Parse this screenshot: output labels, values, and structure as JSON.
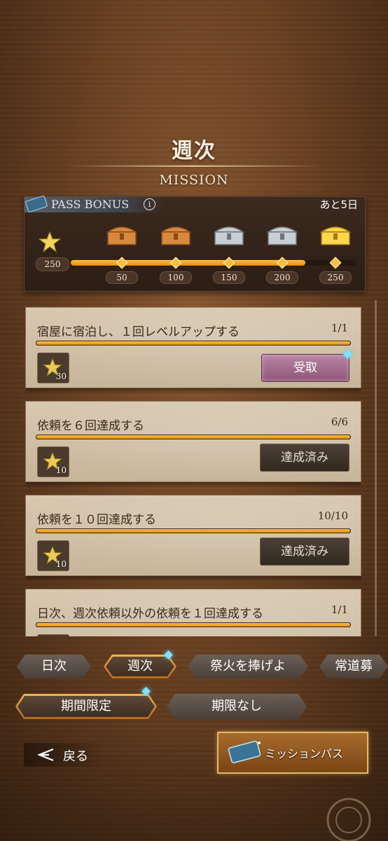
{
  "header": {
    "title": "週次",
    "subtitle": "MISSION"
  },
  "pass_bonus": {
    "label": "PASS BONUS",
    "info_icon": "info-icon",
    "remaining": "あと5日",
    "current_points": "250",
    "progress_fraction": 0.82,
    "milestones": [
      {
        "value": "50",
        "chest": "bronze-chest-icon"
      },
      {
        "value": "100",
        "chest": "bronze-chest-icon"
      },
      {
        "value": "150",
        "chest": "silver-chest-icon"
      },
      {
        "value": "200",
        "chest": "silver-chest-icon"
      },
      {
        "value": "250",
        "chest": "gold-chest-icon"
      }
    ]
  },
  "missions": [
    {
      "title": "宿屋に宿泊し、１回レベルアップする",
      "progress": "1/1",
      "progress_fraction": 1.0,
      "reward": "30",
      "button": "受取",
      "state": "claimable"
    },
    {
      "title": "依頼を６回達成する",
      "progress": "6/6",
      "progress_fraction": 1.0,
      "reward": "10",
      "button": "達成済み",
      "state": "done"
    },
    {
      "title": "依頼を１０回達成する",
      "progress": "10/10",
      "progress_fraction": 1.0,
      "reward": "10",
      "button": "達成済み",
      "state": "done"
    },
    {
      "title": "日次、週次依頼以外の依頼を１回達成する",
      "progress": "1/1",
      "progress_fraction": 1.0,
      "reward": "",
      "button": "",
      "state": "done"
    }
  ],
  "tabs": [
    {
      "label": "日次",
      "active": false
    },
    {
      "label": "週次",
      "active": true
    },
    {
      "label": "祭火を捧げよ",
      "active": false
    },
    {
      "label": "常道募",
      "active": false
    }
  ],
  "subtabs": [
    {
      "label": "期間限定",
      "active": true
    },
    {
      "label": "期限なし",
      "active": false
    }
  ],
  "footer": {
    "back_label": "戻る",
    "pass_label": "ミッションパス"
  },
  "colors": {
    "accent": "#f0a52a",
    "claim": "#a46b8e",
    "notif": "#7fe2ff"
  }
}
